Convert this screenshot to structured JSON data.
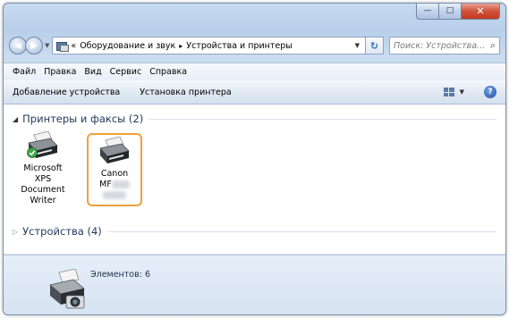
{
  "window": {
    "minimize_label": "—",
    "maximize_label": "□",
    "close_label": "✕"
  },
  "nav": {
    "back_label": "◀",
    "forward_label": "▶",
    "dropdown_label": "▼"
  },
  "address": {
    "prefix": "«",
    "crumb1": "Оборудование и звук",
    "separator": "▸",
    "crumb2": "Устройства и принтеры",
    "dropdown": "▼",
    "refresh": "↻"
  },
  "search": {
    "placeholder": "Поиск: Устройства...",
    "icon": "search-icon"
  },
  "menu": [
    "Файл",
    "Правка",
    "Вид",
    "Сервис",
    "Справка"
  ],
  "commands": {
    "add_device": "Добавление устройства",
    "add_printer": "Установка принтера",
    "views_dropdown": "▼",
    "help": "?"
  },
  "groups": {
    "printers": {
      "arrow": "◢",
      "label": "Принтеры и факсы (2)"
    },
    "devices": {
      "arrow": "▷",
      "label": "Устройства (4)"
    }
  },
  "printers": [
    {
      "name": "Microsoft XPS Document Writer",
      "line1": "Microsoft",
      "line2": "XPS",
      "line3": "Document",
      "line4": "Writer",
      "default": true
    },
    {
      "line1": "Canon",
      "line2": "MF",
      "selected": true
    }
  ],
  "details": {
    "count_label": "Элементов: 6"
  },
  "colors": {
    "selection_border": "#f2a03a",
    "default_check": "#3aa64a",
    "title_gradient": "#c7daf0"
  }
}
